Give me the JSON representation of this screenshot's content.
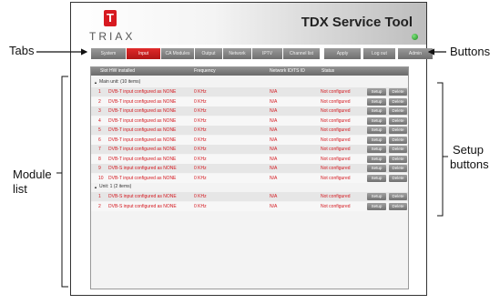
{
  "app": {
    "brand": "TRIAX",
    "logo_glyph": "T",
    "title": "TDX Service Tool",
    "status_color": "#27a327"
  },
  "tabs": [
    {
      "label": "System",
      "active": false
    },
    {
      "label": "Input",
      "active": true
    },
    {
      "label": "CA Modules",
      "active": false
    },
    {
      "label": "Output",
      "active": false
    },
    {
      "label": "Network",
      "active": false
    },
    {
      "label": "IPTV",
      "active": false
    },
    {
      "label": "Channel list",
      "active": false
    }
  ],
  "toolbar": {
    "apply_label": "Apply",
    "logout_label": "Log out",
    "admin_label": "Admin"
  },
  "grid": {
    "headers": {
      "slot": "Slot HW installed",
      "frequency": "Frequency",
      "network": "Network ID/TS ID",
      "status": "Status"
    },
    "groups": [
      {
        "label": "Main unit: (10 items)",
        "rows": [
          {
            "slot": "1",
            "type": "DVB-T input configured as NONE",
            "freq": "0 KHz",
            "net": "N/A",
            "status": "Not configured"
          },
          {
            "slot": "2",
            "type": "DVB-T input configured as NONE",
            "freq": "0 KHz",
            "net": "N/A",
            "status": "Not configured"
          },
          {
            "slot": "3",
            "type": "DVB-T input configured as NONE",
            "freq": "0 KHz",
            "net": "N/A",
            "status": "Not configured"
          },
          {
            "slot": "4",
            "type": "DVB-T input configured as NONE",
            "freq": "0 KHz",
            "net": "N/A",
            "status": "Not configured"
          },
          {
            "slot": "5",
            "type": "DVB-T input configured as NONE",
            "freq": "0 KHz",
            "net": "N/A",
            "status": "Not configured"
          },
          {
            "slot": "6",
            "type": "DVB-T input configured as NONE",
            "freq": "0 KHz",
            "net": "N/A",
            "status": "Not configured"
          },
          {
            "slot": "7",
            "type": "DVB-T input configured as NONE",
            "freq": "0 KHz",
            "net": "N/A",
            "status": "Not configured"
          },
          {
            "slot": "8",
            "type": "DVB-T input configured as NONE",
            "freq": "0 KHz",
            "net": "N/A",
            "status": "Not configured"
          },
          {
            "slot": "9",
            "type": "DVB-S input configured as NONE",
            "freq": "0 KHz",
            "net": "N/A",
            "status": "Not configured"
          },
          {
            "slot": "10",
            "type": "DVB-T input configured as NONE",
            "freq": "0 KHz",
            "net": "N/A",
            "status": "Not configured"
          }
        ]
      },
      {
        "label": "Unit: 1 (2 items)",
        "rows": [
          {
            "slot": "1",
            "type": "DVB-S input configured as NONE",
            "freq": "0 KHz",
            "net": "N/A",
            "status": "Not configured"
          },
          {
            "slot": "2",
            "type": "DVB-S input configured as NONE",
            "freq": "0 KHz",
            "net": "N/A",
            "status": "Not configured"
          }
        ]
      }
    ],
    "setup_label": "Setup",
    "delete_label": "Delete"
  },
  "annotations": {
    "tabs": "Tabs",
    "buttons": "Buttons",
    "setup_buttons_line1": "Setup",
    "setup_buttons_line2": "buttons",
    "module_list_line1": "Module",
    "module_list_line2": "list"
  }
}
